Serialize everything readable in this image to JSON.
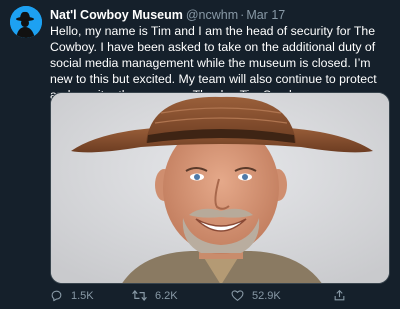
{
  "tweet": {
    "author": {
      "display_name": "Nat'l Cowboy Museum",
      "handle": "@ncwhm",
      "avatar_icon": "cowboy-silhouette-avatar-icon"
    },
    "separator": "·",
    "date": "Mar 17",
    "text": "Hello, my name is Tim and I am the head of security for The Cowboy. I have been asked to take on the additional duty of social media management while the museum is closed. I’m new to this but excited. My team will also continue to protect and monitor the museum. Thanks, Tim Send",
    "media": {
      "type": "photo",
      "icon": "smiling-man-in-cowboy-hat-photo"
    },
    "actions": {
      "reply": {
        "icon": "reply-icon",
        "count": "1.5K"
      },
      "retweet": {
        "icon": "retweet-icon",
        "count": "6.2K"
      },
      "like": {
        "icon": "heart-icon",
        "count": "52.9K"
      },
      "share": {
        "icon": "share-icon"
      }
    }
  },
  "colors": {
    "background": "#15202b",
    "accent": "#1da1f2",
    "secondary_text": "#8899a6"
  }
}
